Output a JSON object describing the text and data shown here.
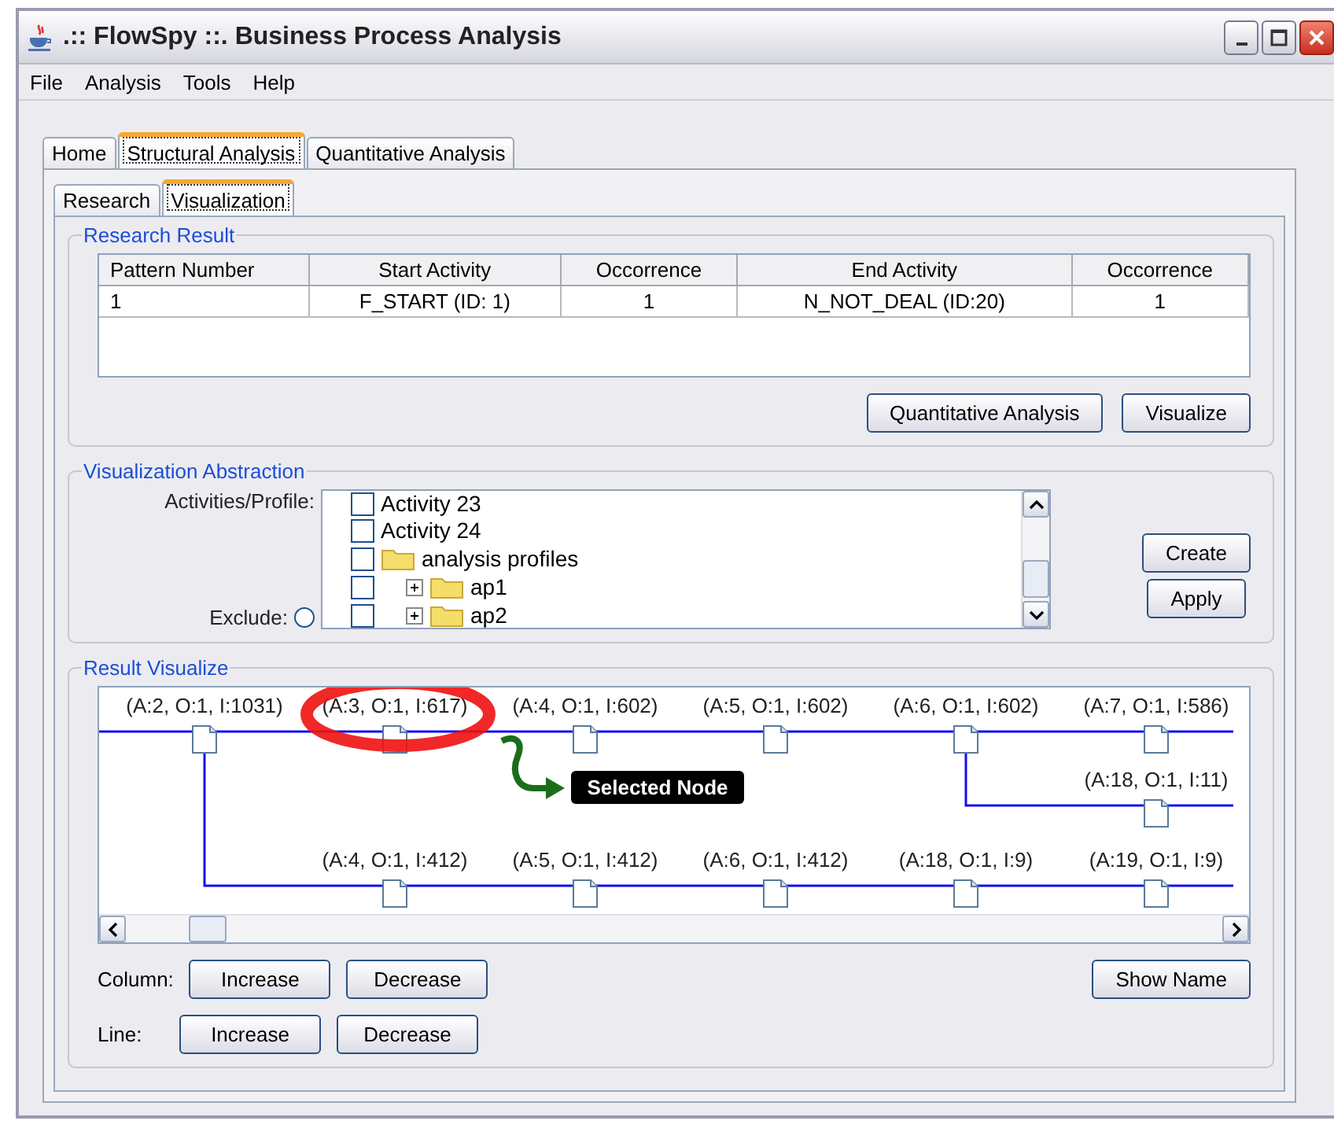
{
  "window": {
    "title": ".:: FlowSpy ::. Business Process Analysis"
  },
  "menu": [
    "File",
    "Analysis",
    "Tools",
    "Help"
  ],
  "tabs": [
    {
      "label": "Home",
      "selected": false
    },
    {
      "label": "Structural Analysis",
      "selected": true
    },
    {
      "label": "Quantitative Analysis",
      "selected": false
    }
  ],
  "subtabs": [
    {
      "label": "Research",
      "selected": false
    },
    {
      "label": "Visualization",
      "selected": true
    }
  ],
  "research_result": {
    "title": "Research Result",
    "columns": [
      "Pattern Number",
      "Start Activity",
      "Occorrence",
      "End Activity",
      "Occorrence"
    ],
    "rows": [
      [
        "1",
        "F_START (ID: 1)",
        "1",
        "N_NOT_DEAL (ID:20)",
        "1"
      ]
    ],
    "buttons": [
      "Quantitative Analysis",
      "Visualize"
    ]
  },
  "abstraction": {
    "title": "Visualization Abstraction",
    "list_label": "Activities/Profile:",
    "exclude_label": "Exclude:",
    "exclude_checked": false,
    "tree": [
      {
        "kind": "activity",
        "label": "Activity 23",
        "checked": false
      },
      {
        "kind": "activity",
        "label": "Activity 24",
        "checked": false
      },
      {
        "kind": "folder",
        "label": "analysis profiles",
        "checked": false,
        "children": [
          {
            "kind": "folder",
            "label": "ap1",
            "checked": false,
            "expanded": false
          },
          {
            "kind": "folder",
            "label": "ap2",
            "checked": false,
            "expanded": false
          }
        ]
      }
    ],
    "buttons": [
      "Create",
      "Apply"
    ]
  },
  "result": {
    "title": "Result Visualize",
    "rows": [
      [
        {
          "label": "(A:2, O:1, I:1031)",
          "selected": false
        },
        {
          "label": "(A:3, O:1, I:617)",
          "selected": true
        },
        {
          "label": "(A:4, O:1, I:602)",
          "selected": false
        },
        {
          "label": "(A:5, O:1, I:602)",
          "selected": false
        },
        {
          "label": "(A:6, O:1, I:602)",
          "selected": false
        },
        {
          "label": "(A:7, O:1, I:586)",
          "selected": false
        }
      ],
      [
        null,
        null,
        null,
        null,
        null,
        {
          "label": "(A:18, O:1, I:11)",
          "selected": false
        }
      ],
      [
        null,
        {
          "label": "(A:4, O:1, I:412)",
          "selected": false
        },
        {
          "label": "(A:5, O:1, I:412)",
          "selected": false
        },
        {
          "label": "(A:6, O:1, I:412)",
          "selected": false
        },
        {
          "label": "(A:18, O:1, I:9)",
          "selected": false
        },
        {
          "label": "(A:19, O:1, I:9)",
          "selected": false
        }
      ]
    ],
    "callout": "Selected Node",
    "column_label": "Column:",
    "line_label": "Line:",
    "column_buttons": [
      "Increase",
      "Decrease"
    ],
    "line_buttons": [
      "Increase",
      "Decrease"
    ],
    "show_name": "Show Name"
  }
}
